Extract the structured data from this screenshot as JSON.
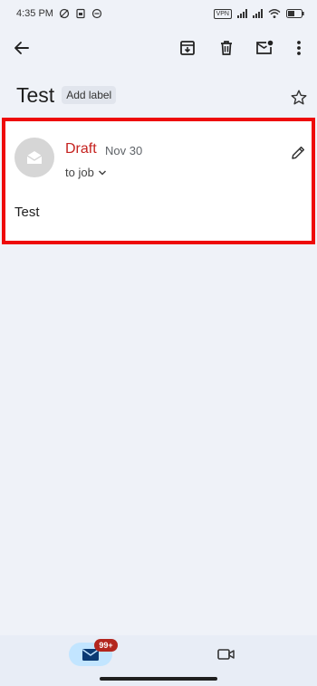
{
  "status_bar": {
    "time": "4:35 PM",
    "vpn": "VPN"
  },
  "app_bar": {
    "back_icon": "arrow-back-icon",
    "archive_icon": "archive-icon",
    "delete_icon": "delete-icon",
    "mark_unread_icon": "mark-unread-icon",
    "more_icon": "more-vert-icon"
  },
  "thread": {
    "subject": "Test",
    "add_label": "Add label",
    "star_icon": "star-outline-icon"
  },
  "message": {
    "status": "Draft",
    "date": "Nov 30",
    "recipient": "to job",
    "body": "Test",
    "status_color": "#c5221f",
    "highlight_color": "#ee0a0a"
  },
  "bottom_nav": {
    "mail_badge": "99+",
    "mail_icon": "mail-icon",
    "meet_icon": "video-camera-icon",
    "active_tab_color": "#c2e5ff"
  }
}
